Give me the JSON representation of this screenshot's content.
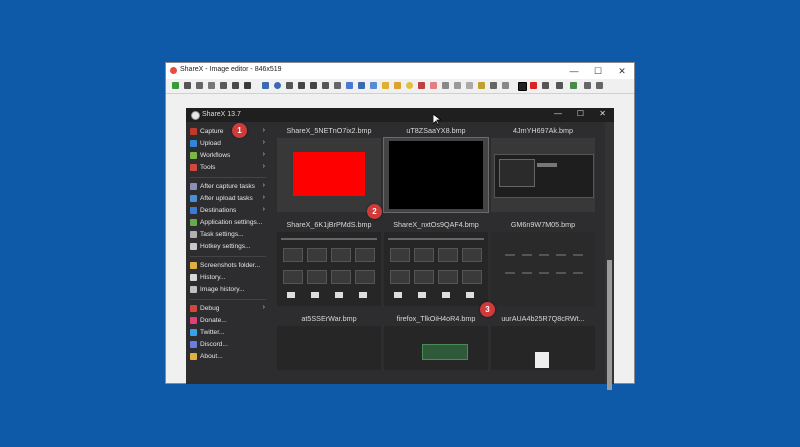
{
  "editor": {
    "title": "ShareX - Image editor - 846x519",
    "minimize": "—",
    "maximize": "☐",
    "close": "✕"
  },
  "sharex": {
    "title": "ShareX 13.7",
    "minimize": "—",
    "maximize": "☐",
    "close": "✕"
  },
  "menu": [
    {
      "label": "Capture",
      "icon": "capture-icon",
      "color": "#c0392b",
      "arrow": "›"
    },
    {
      "label": "Upload",
      "icon": "upload-icon",
      "color": "#2f86d6",
      "arrow": "›"
    },
    {
      "label": "Workflows",
      "icon": "workflows-icon",
      "color": "#7ab648",
      "arrow": "›"
    },
    {
      "label": "Tools",
      "icon": "tools-icon",
      "color": "#d04a3c",
      "arrow": "›"
    },
    {
      "label": "After capture tasks",
      "icon": "after-capture-icon",
      "color": "#8a8fb8",
      "arrow": "›"
    },
    {
      "label": "After upload tasks",
      "icon": "after-upload-icon",
      "color": "#4a90d6",
      "arrow": "›"
    },
    {
      "label": "Destinations",
      "icon": "destinations-icon",
      "color": "#3a7bd5",
      "arrow": "›"
    },
    {
      "label": "Application settings...",
      "icon": "app-settings-icon",
      "color": "#6aa84f",
      "arrow": ""
    },
    {
      "label": "Task settings...",
      "icon": "task-settings-icon",
      "color": "#b0b0b0",
      "arrow": ""
    },
    {
      "label": "Hotkey settings...",
      "icon": "hotkey-settings-icon",
      "color": "#c8c8c8",
      "arrow": ""
    },
    {
      "label": "Screenshots folder...",
      "icon": "folder-icon",
      "color": "#e0b040",
      "arrow": ""
    },
    {
      "label": "History...",
      "icon": "history-icon",
      "color": "#d8d8d8",
      "arrow": ""
    },
    {
      "label": "Image history...",
      "icon": "image-history-icon",
      "color": "#c0c0c0",
      "arrow": ""
    },
    {
      "label": "Debug",
      "icon": "debug-icon",
      "color": "#d04a3c",
      "arrow": "›"
    },
    {
      "label": "Donate...",
      "icon": "heart-icon",
      "color": "#e0407a",
      "arrow": ""
    },
    {
      "label": "Twitter...",
      "icon": "twitter-icon",
      "color": "#3aa0e8",
      "arrow": ""
    },
    {
      "label": "Discord...",
      "icon": "discord-icon",
      "color": "#6a7de0",
      "arrow": ""
    },
    {
      "label": "About...",
      "icon": "about-icon",
      "color": "#e0b040",
      "arrow": ""
    }
  ],
  "thumbnails": [
    {
      "name": "ShareX_5NETnO7ix2.bmp",
      "kind": "red"
    },
    {
      "name": "uT8ZSaaYX8.bmp",
      "kind": "black"
    },
    {
      "name": "4JmYH697Ak.bmp",
      "kind": "screen"
    },
    {
      "name": "ShareX_6K1jBrPMdS.bmp",
      "kind": "grid"
    },
    {
      "name": "ShareX_nxtOs9QAF4.bmp",
      "kind": "grid"
    },
    {
      "name": "GM6n9W7M05.bmp",
      "kind": "dots"
    },
    {
      "name": "at5SSErWar.bmp",
      "kind": "dark"
    },
    {
      "name": "firefox_TlkOiH4oR4.bmp",
      "kind": "firefox"
    },
    {
      "name": "uurAUA4b25R7Q8cRWt...",
      "kind": "doc"
    }
  ],
  "badges": [
    "1",
    "2",
    "3"
  ],
  "colors": {
    "desktop": "#0e5aa8",
    "badge": "#cf3b3b",
    "red_thumb": "#ff0000"
  }
}
